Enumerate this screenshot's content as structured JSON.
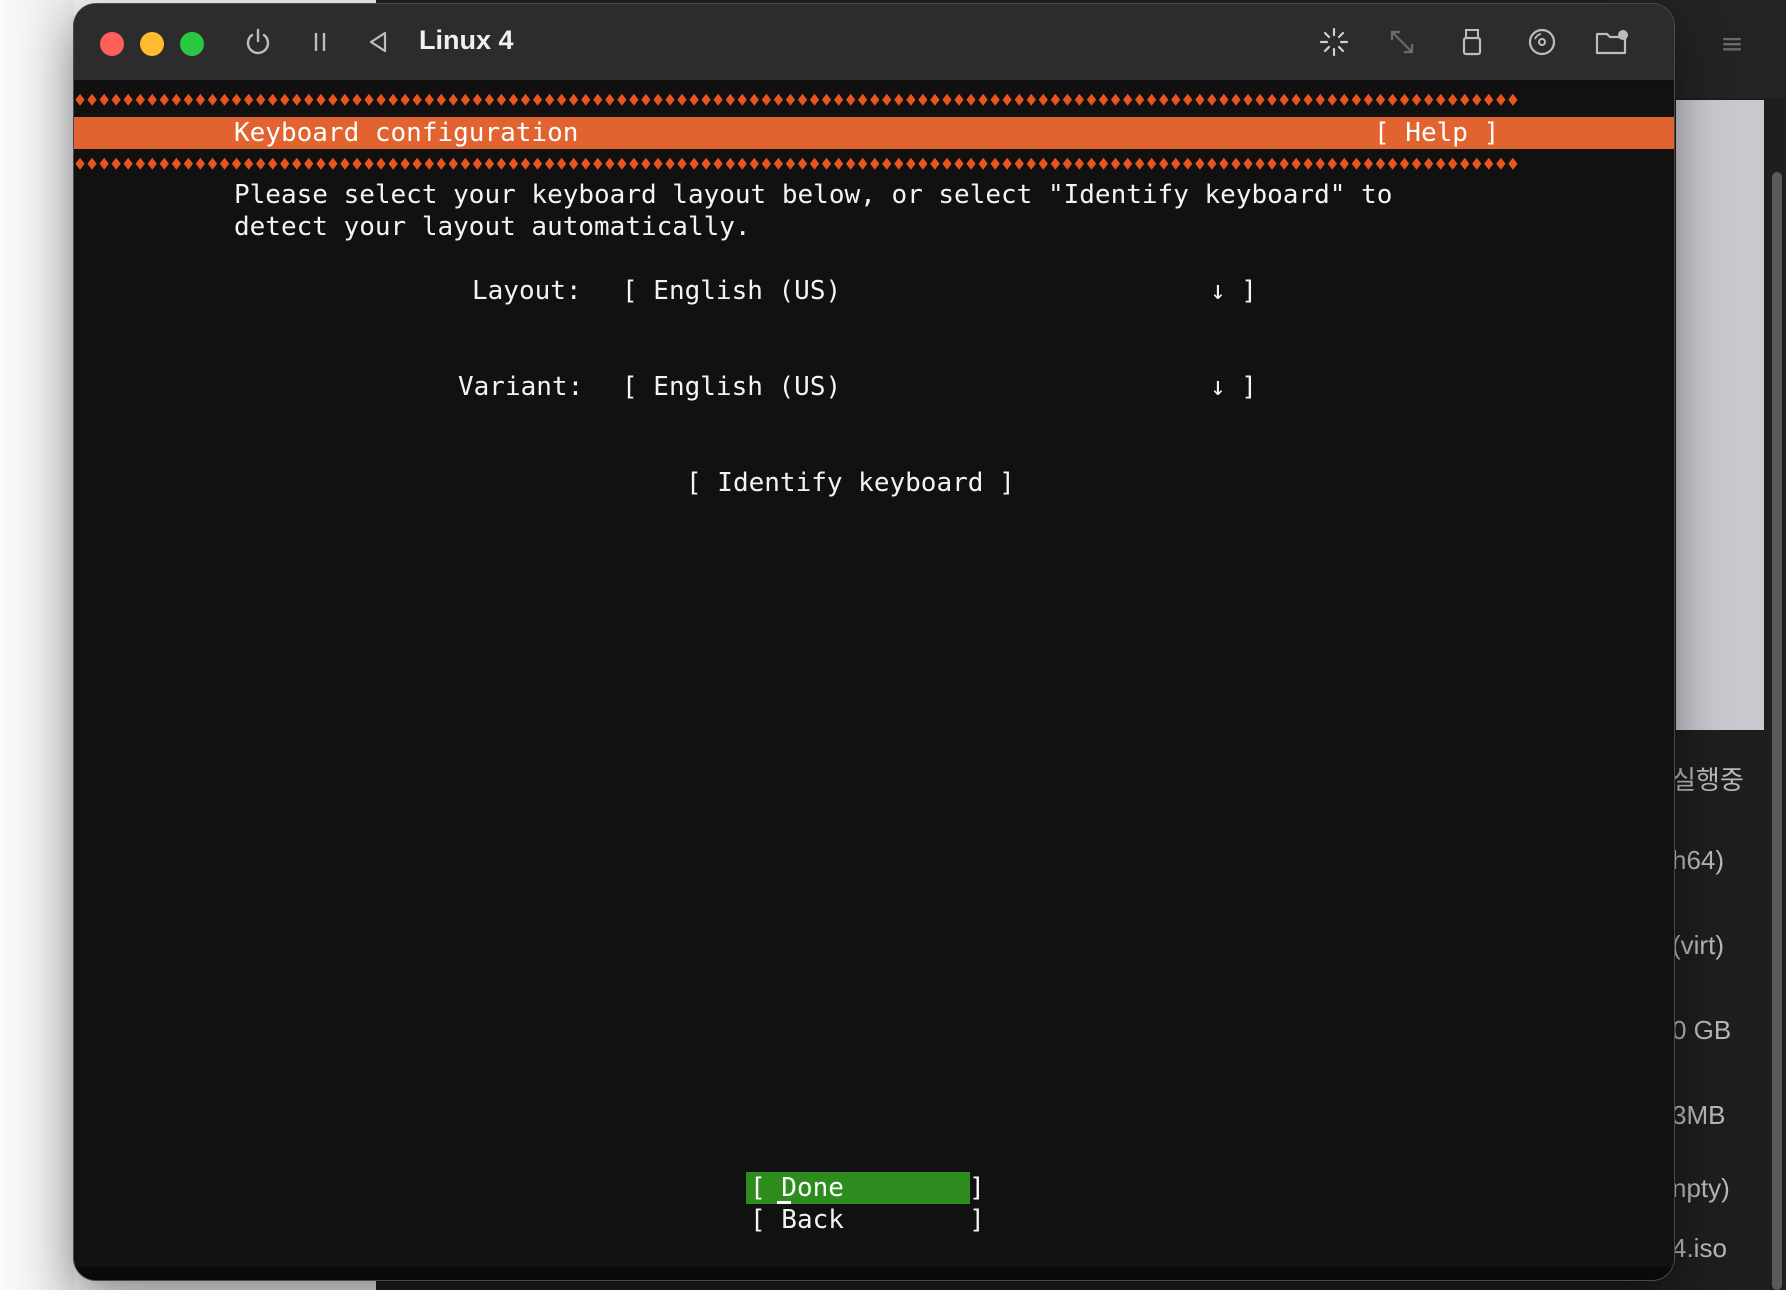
{
  "vm_window": {
    "title": "Linux 4",
    "toolbar_icons": [
      "power-icon",
      "pause-icon",
      "back-icon",
      "spinner-icon",
      "resize-icon",
      "usb-icon",
      "disc-icon",
      "shared-folder-icon"
    ]
  },
  "installer": {
    "header_title": "Keyboard configuration",
    "help_label": "[ Help ]",
    "intro_line1": "Please select your keyboard layout below, or select \"Identify keyboard\" to",
    "intro_line2": "detect your layout automatically.",
    "layout_label": "Layout:",
    "layout_value": "[ English (US)",
    "layout_arrow": "↓ ]",
    "variant_label": "Variant:",
    "variant_value": "[ English (US)",
    "variant_arrow": "↓ ]",
    "identify_button": "[ Identify keyboard ]",
    "done_button": "[ Done        ]",
    "back_button": "[ Back        ]",
    "accent_color": "#e95420",
    "done_color": "#2e8b1e"
  },
  "background_app": {
    "list_items": [
      "실행중",
      "h64)",
      "(virt)",
      "0 GB",
      "3MB",
      "npty)",
      "4.iso"
    ]
  }
}
